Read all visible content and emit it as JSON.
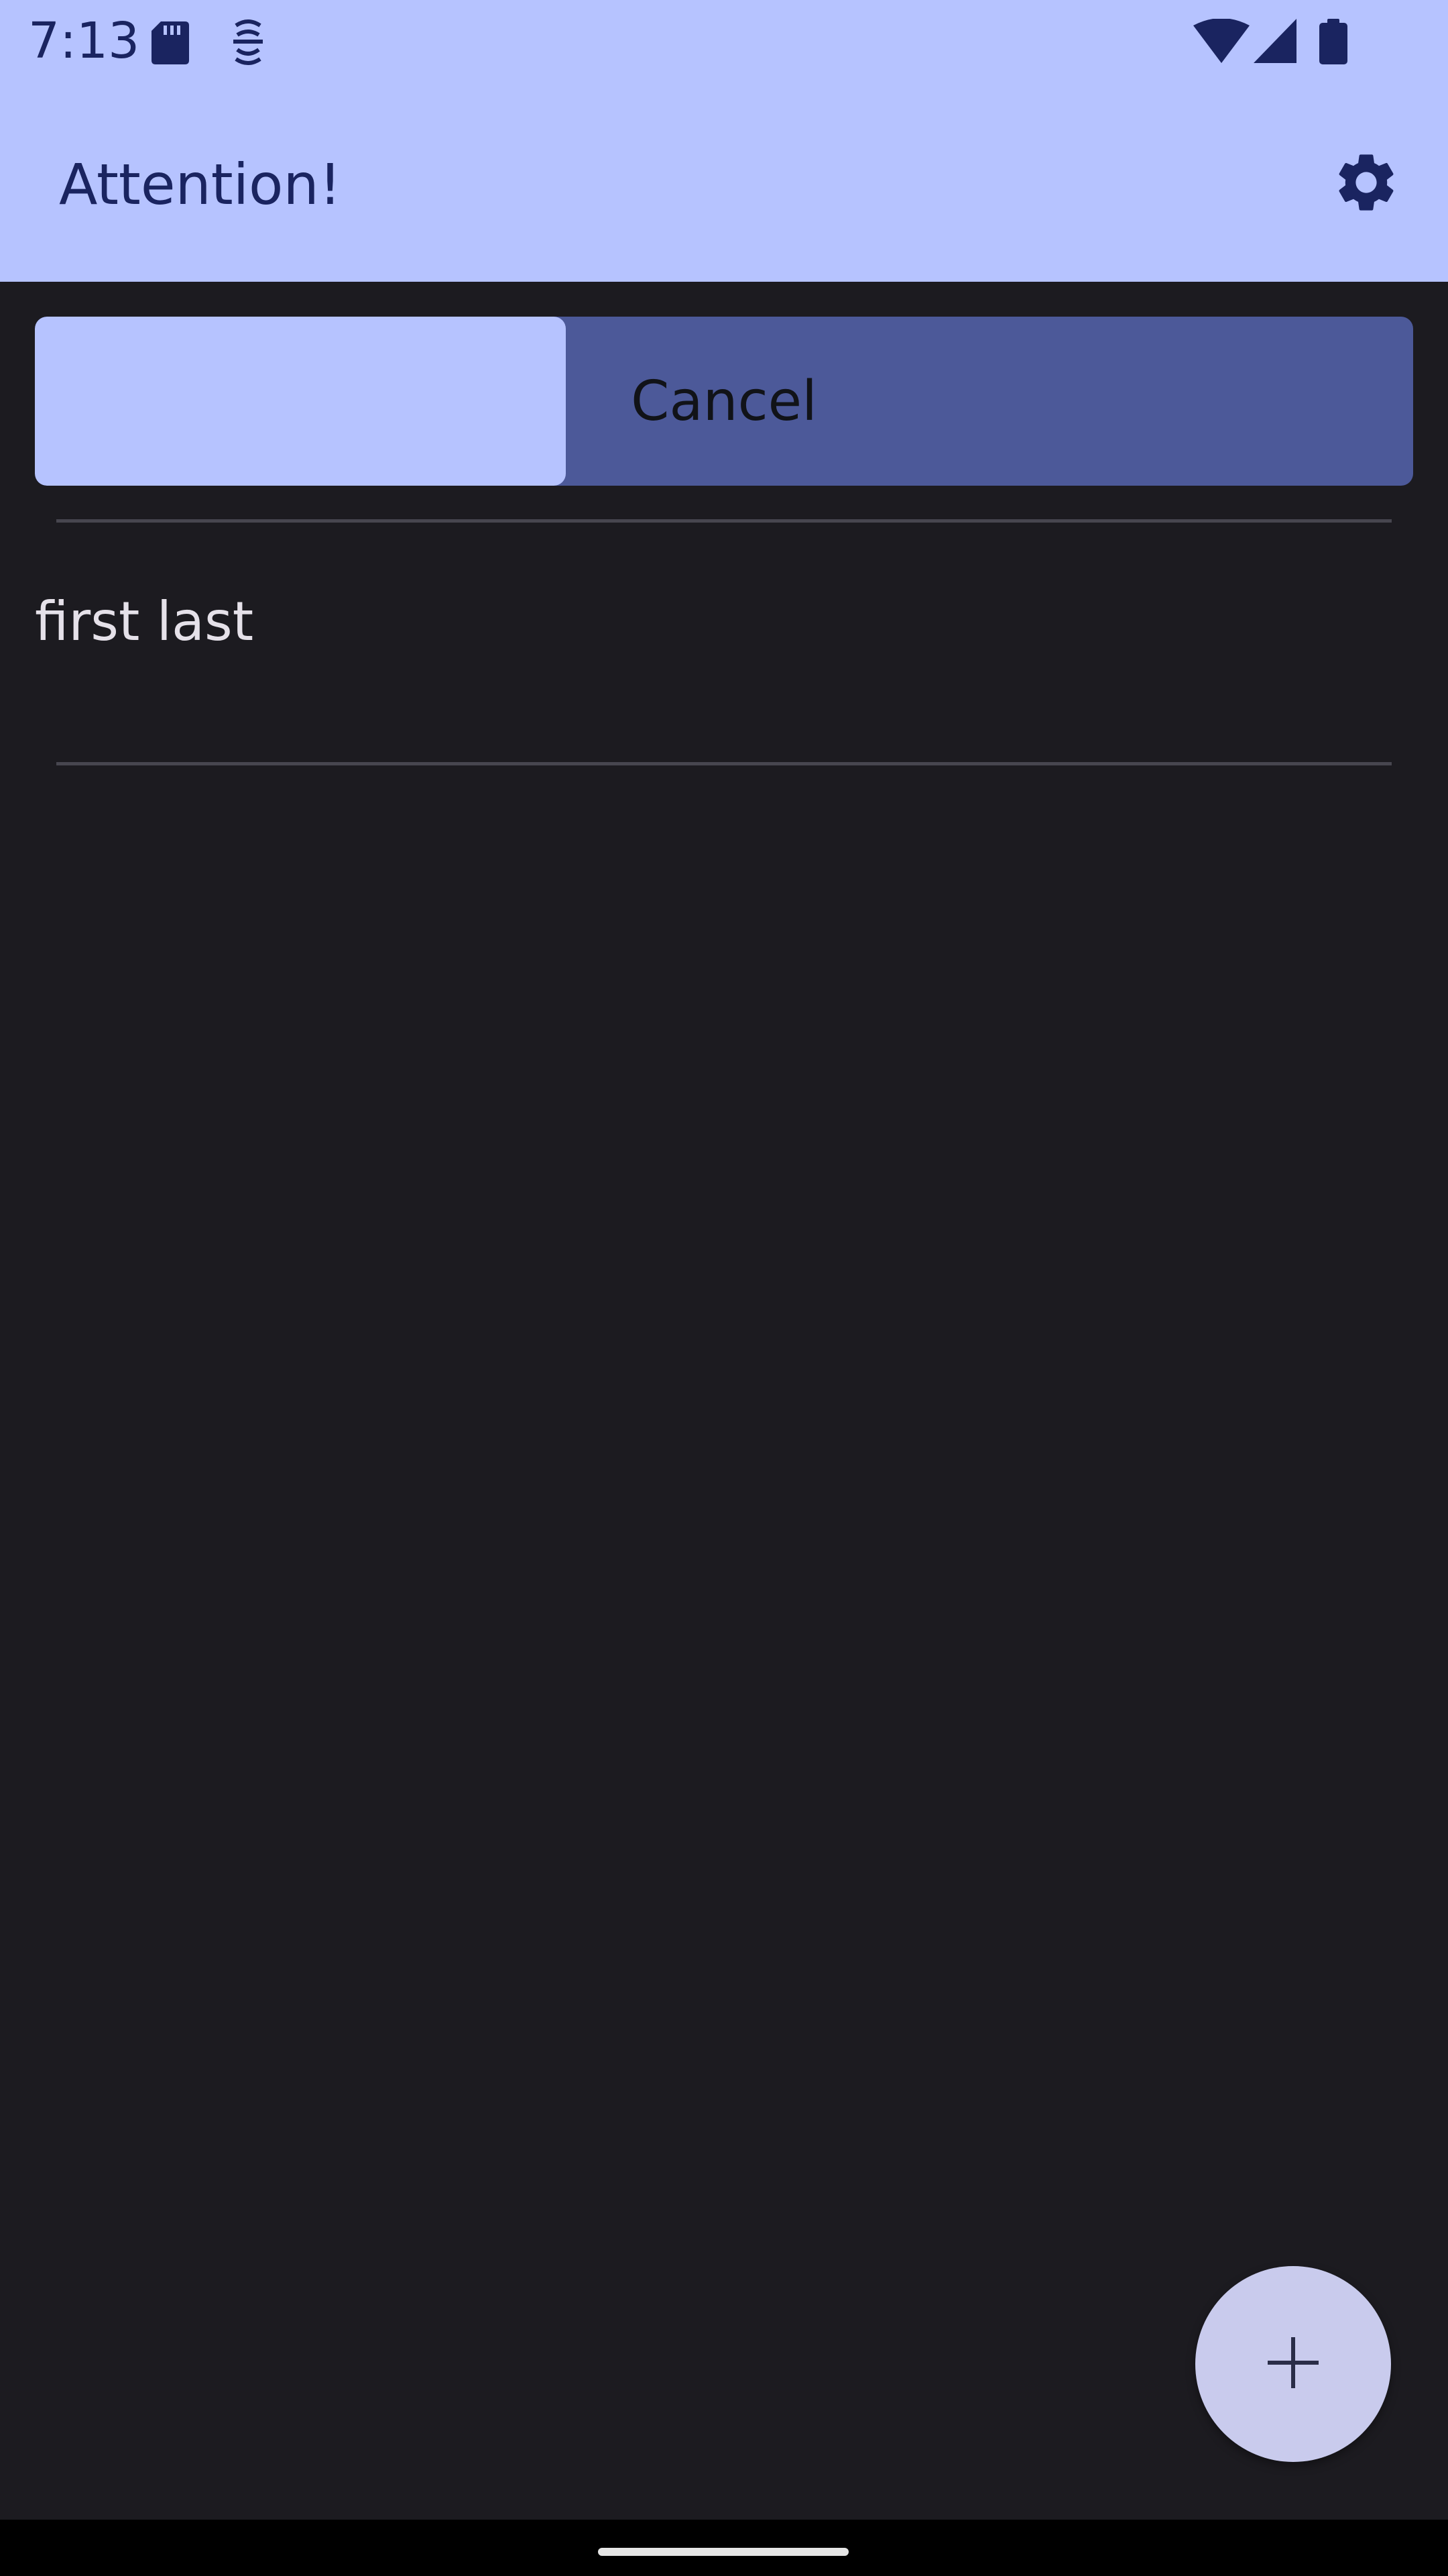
{
  "status_bar": {
    "time": "7:13",
    "left_icons": [
      "sd-card-icon",
      "accessibility-icon"
    ],
    "right_icons": [
      "wifi-icon",
      "cell-signal-icon",
      "battery-icon"
    ]
  },
  "app_bar": {
    "title": "Attention!",
    "settings_icon": "gear-icon"
  },
  "cancel_bar": {
    "label": "Cancel",
    "progress_fraction": 0.385
  },
  "list": {
    "items": [
      {
        "name": "first last"
      }
    ]
  },
  "fab": {
    "icon": "plus-icon"
  },
  "colors": {
    "header_bg": "#b6c3ff",
    "header_text": "#1a2460",
    "background": "#1c1b20",
    "cancel_bar_bg": "#4c5999",
    "cancel_progress": "#b6c3ff",
    "fab_bg": "#c9cbed"
  }
}
